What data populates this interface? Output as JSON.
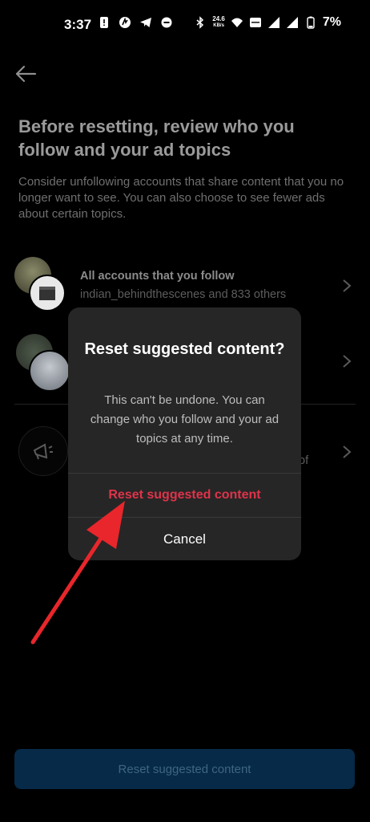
{
  "status_bar": {
    "time": "3:37",
    "net_speed_value": "24.6",
    "net_speed_unit": "KB/s",
    "battery_percent": "7%"
  },
  "header": {
    "title": "Before resetting, review who you follow and your ad topics",
    "description": "Consider unfollowing accounts that share content that you no longer want to see. You can also choose to see fewer ads about certain topics."
  },
  "rows": [
    {
      "title": "All accounts that you follow",
      "subtitle": "indian_behindthescenes and 833 others"
    },
    {
      "title": "",
      "subtitle": ""
    },
    {
      "title": "",
      "subtitle": "of"
    }
  ],
  "dialog": {
    "title": "Reset suggested content?",
    "body": "This can't be undone. You can change who you follow and your ad topics at any time.",
    "primary_label": "Reset suggested content",
    "cancel_label": "Cancel"
  },
  "footer": {
    "button_label": "Reset suggested content"
  },
  "colors": {
    "background": "#000000",
    "dialog_background": "#262626",
    "destructive": "#e0334a",
    "annotation_arrow": "#e8262b",
    "disabled_button": "#062a48"
  }
}
